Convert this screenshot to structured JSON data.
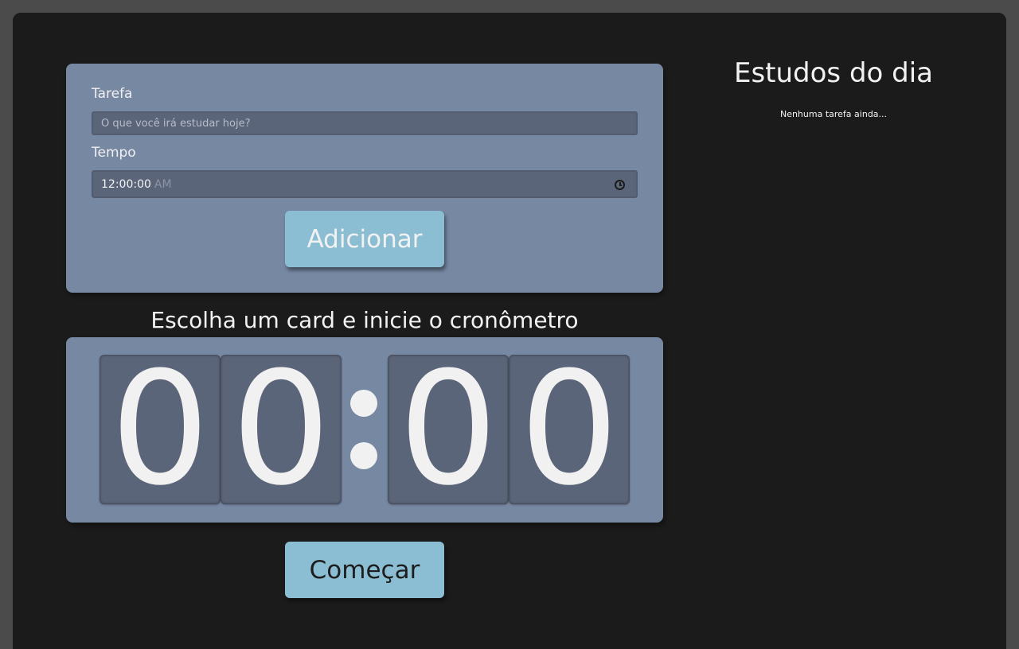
{
  "form": {
    "task_label": "Tarefa",
    "task_placeholder": "O que você irá estudar hoje?",
    "time_label": "Tempo",
    "time_value": "12:00:00",
    "time_ampm": "AM",
    "add_button": "Adicionar"
  },
  "timer": {
    "title": "Escolha um card e inicie o cronômetro",
    "digits": [
      "0",
      "0",
      "0",
      "0"
    ],
    "start_button": "Começar"
  },
  "sidebar": {
    "title": "Estudos do dia",
    "empty_message": "Nenhuma tarefa ainda..."
  },
  "colors": {
    "background": "#1b1b1b",
    "card": "#7788a3",
    "digit_bg": "#5b6579",
    "button": "#8bbdd3"
  }
}
